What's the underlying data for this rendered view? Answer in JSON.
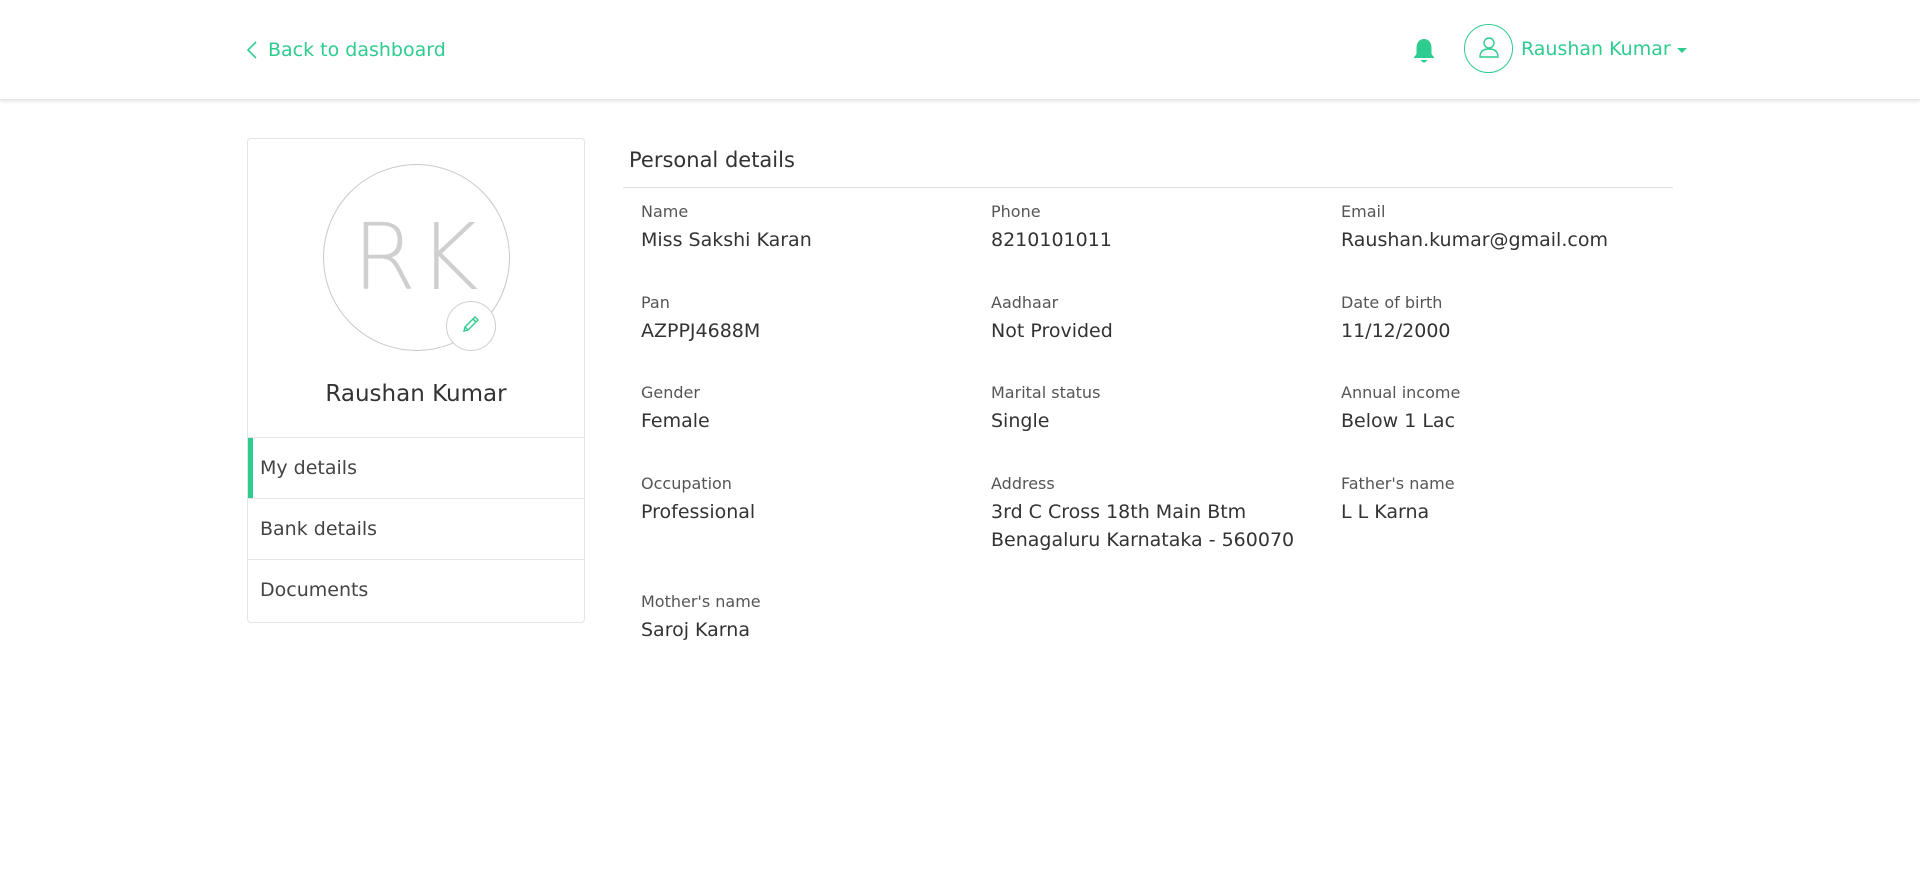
{
  "header": {
    "back_label": "Back to dashboard",
    "user_name": "Raushan Kumar",
    "accent_color": "#2ecc8e",
    "icons": [
      "chevron-left-icon",
      "bell-icon",
      "user-icon",
      "caret-down-icon"
    ]
  },
  "profile": {
    "initials": "RK",
    "name": "Raushan Kumar",
    "edit_icon": "pencil-icon"
  },
  "menu": {
    "items": [
      {
        "label": "My details",
        "active": true
      },
      {
        "label": "Bank details",
        "active": false
      },
      {
        "label": "Documents",
        "active": false
      }
    ]
  },
  "details": {
    "title": "Personal details",
    "fields": [
      {
        "label": "Name",
        "value": "Miss Sakshi Karan"
      },
      {
        "label": "Phone",
        "value": "8210101011"
      },
      {
        "label": "Email",
        "value": "Raushan.kumar@gmail.com"
      },
      {
        "label": "Pan",
        "value": "AZPPJ4688M"
      },
      {
        "label": "Aadhaar",
        "value": "Not Provided"
      },
      {
        "label": "Date of birth",
        "value": "11/12/2000"
      },
      {
        "label": "Gender",
        "value": "Female"
      },
      {
        "label": "Marital status",
        "value": "Single"
      },
      {
        "label": "Annual income",
        "value": "Below 1 Lac"
      },
      {
        "label": "Occupation",
        "value": "Professional"
      },
      {
        "label": "Address",
        "value": "3rd C Cross 18th Main Btm",
        "value_line2": "Benagaluru Karnataka - 560070"
      },
      {
        "label": "Father's name",
        "value": "L L Karna"
      },
      {
        "label": "Mother's name",
        "value": "Saroj Karna"
      }
    ]
  }
}
